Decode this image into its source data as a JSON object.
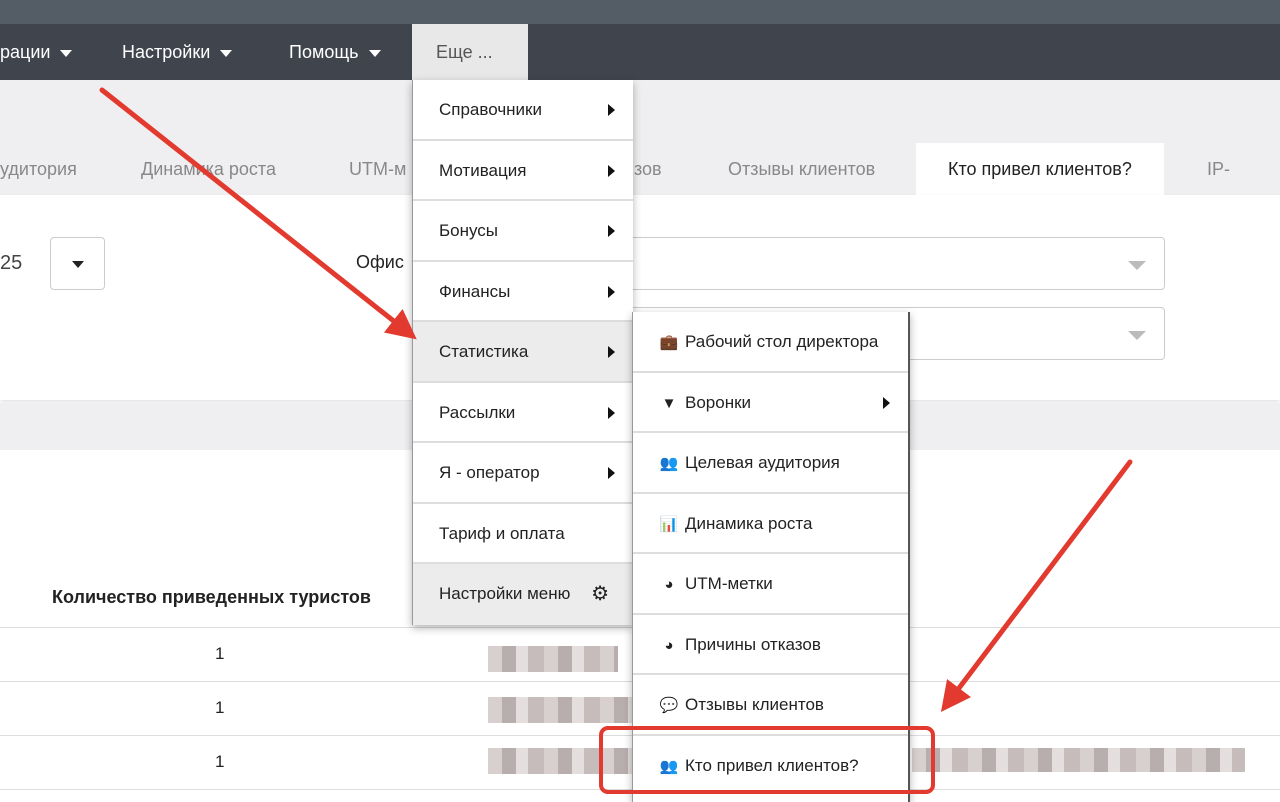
{
  "nav": {
    "items": [
      "рации",
      "Настройки",
      "Помощь"
    ],
    "more": "Еще ..."
  },
  "tabs": [
    "удитория",
    "Динамика роста",
    "UTM-м",
    "зов",
    "Отзывы клиентов",
    "Кто привел клиентов?",
    "IP-телеф"
  ],
  "filters": {
    "date_value": "25",
    "office_label": "Офис"
  },
  "table": {
    "header": "Количество приведенных туристов",
    "rows": [
      "1",
      "1",
      "1"
    ]
  },
  "menu": {
    "items": [
      {
        "label": "Справочники",
        "submenu": true
      },
      {
        "label": "Мотивация",
        "submenu": true
      },
      {
        "label": "Бонусы",
        "submenu": true
      },
      {
        "label": "Финансы",
        "submenu": true
      },
      {
        "label": "Статистика",
        "submenu": true
      },
      {
        "label": "Рассылки",
        "submenu": true
      },
      {
        "label": "Я - оператор",
        "submenu": true
      },
      {
        "label": "Тариф и оплата",
        "submenu": false
      },
      {
        "label": "Настройки меню",
        "submenu": false
      }
    ]
  },
  "submenu": {
    "items": [
      {
        "label": "Рабочий стол директора",
        "icon": "briefcase-icon"
      },
      {
        "label": "Воронки",
        "icon": "funnel-icon"
      },
      {
        "label": "Целевая аудитория",
        "icon": "users-icon"
      },
      {
        "label": "Динамика роста",
        "icon": "bar-chart-icon"
      },
      {
        "label": "UTM-метки",
        "icon": "pie-chart-icon"
      },
      {
        "label": "Причины отказов",
        "icon": "pie-chart-icon"
      },
      {
        "label": "Отзывы клиентов",
        "icon": "comments-icon"
      },
      {
        "label": "Кто привел клиентов?",
        "icon": "users-icon"
      }
    ]
  },
  "colors": {
    "annotation": "#e23a2e",
    "nav_bg": "#40454d"
  }
}
